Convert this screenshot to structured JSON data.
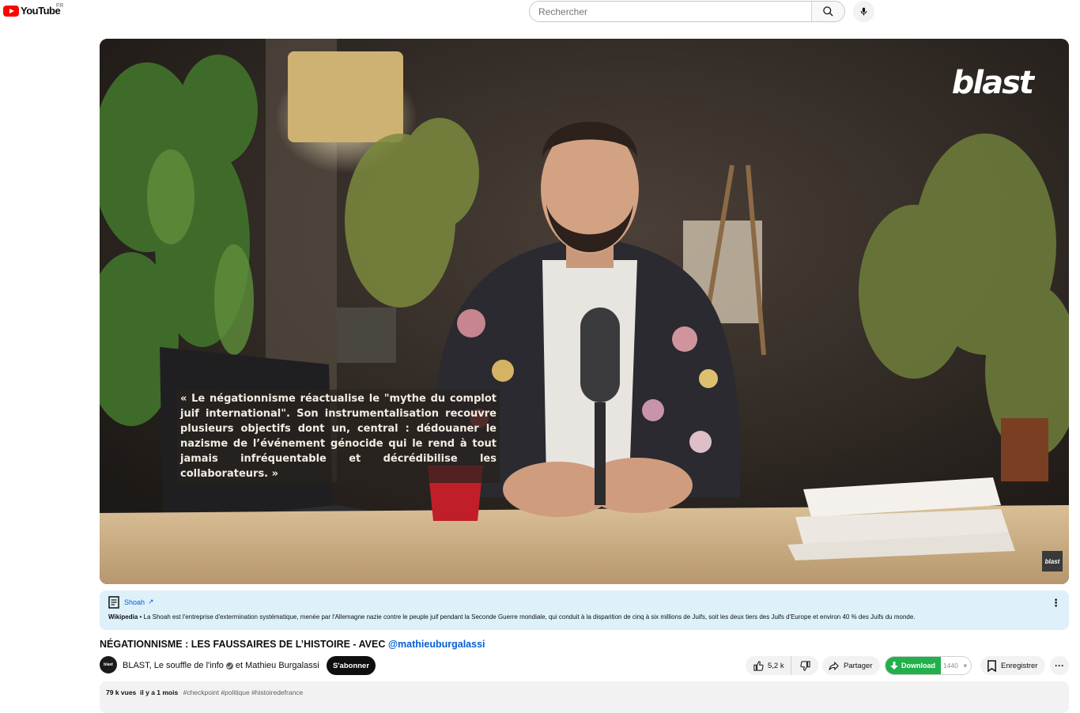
{
  "header": {
    "logo_text": "YouTube",
    "country": "FR",
    "search_placeholder": "Rechercher"
  },
  "player": {
    "watermark": "blast",
    "corner_logo": "blast",
    "quote": "« Le négationnisme réactualise le \"mythe du complot juif international\". Son instrumentalisation recouvre plusieurs objectifs dont un, central : dédouaner le nazisme de l’événement génocide qui le rend à tout jamais infréquentable et décrédibilise les collaborateurs. »"
  },
  "info_panel": {
    "title": "Shoah",
    "source": "Wikipedia",
    "text": " • La Shoah est l'entreprise d'extermination systématique, menée par l'Allemagne nazie contre le peuple juif pendant la Seconde Guerre mondiale, qui conduit à la disparition de cinq à six millions de Juifs, soit les deux tiers des Juifs d'Europe et environ 40 % des Juifs du monde."
  },
  "video": {
    "title": "NÉGATIONNISME : LES FAUSSAIRES DE L’HISTOIRE - AVEC ",
    "title_mention": "@mathieuburgalassi"
  },
  "channel": {
    "avatar_text": "blast",
    "name": "BLAST, Le souffle de l'info",
    "collaborator_prefix": "et",
    "collaborator": "Mathieu Burgalassi",
    "subscribe_label": "S'abonner"
  },
  "actions": {
    "likes": "5,2 k",
    "share_label": "Partager",
    "download_label": "Download",
    "quality": "1440",
    "save_label": "Enregistrer"
  },
  "description": {
    "views": "79 k vues",
    "date": "il y a 1 mois",
    "tags": "#checkpoint #politique #histoiredefrance"
  },
  "colors": {
    "brand_red": "#ff0000",
    "link_blue": "#065fd4",
    "download_green": "#22b04b",
    "info_bg": "#def1fb"
  }
}
